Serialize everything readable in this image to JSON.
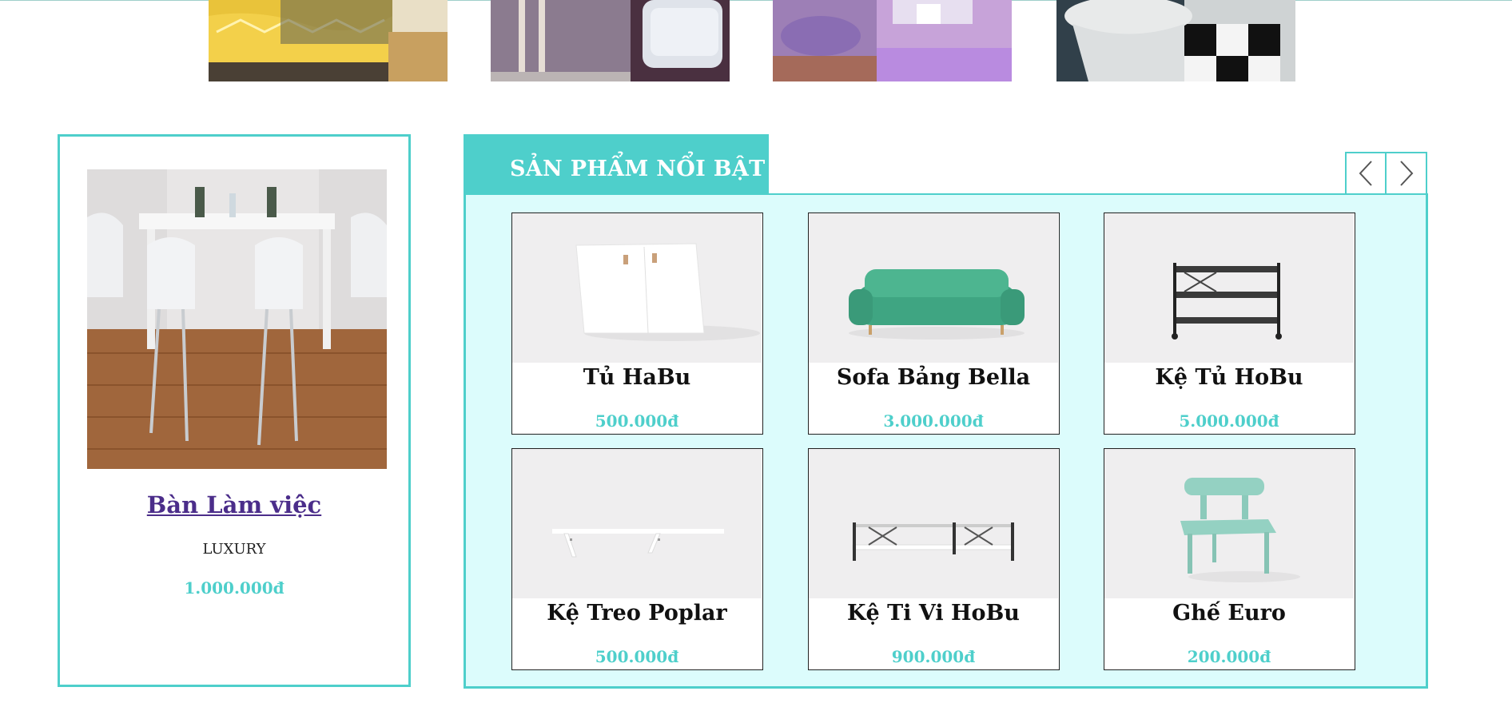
{
  "categories": [
    {
      "name": "bedroom-category-image"
    },
    {
      "name": "livingroom-category-image"
    },
    {
      "name": "kids-room-category-image"
    },
    {
      "name": "bathroom-category-image"
    }
  ],
  "feature": {
    "title": "Bàn Làm việc",
    "subtitle": "LUXURY",
    "price": "1.000.000đ"
  },
  "panel": {
    "heading": "SẢN PHẨM NỔI BẬT",
    "prev_icon": "chevron-left-icon",
    "next_icon": "chevron-right-icon"
  },
  "products": [
    {
      "name": "Tủ HaBu",
      "price": "500.000đ"
    },
    {
      "name": "Sofa Bảng Bella",
      "price": "3.000.000đ"
    },
    {
      "name": "Kệ Tủ HoBu",
      "price": "5.000.000đ"
    },
    {
      "name": "Kệ Treo Poplar",
      "price": "500.000đ"
    },
    {
      "name": "Kệ Ti Vi HoBu",
      "price": "900.000đ"
    },
    {
      "name": "Ghế Euro",
      "price": "200.000đ"
    }
  ],
  "colors": {
    "accent": "#4ecfcb",
    "panel_bg": "#dcfcfc",
    "link": "#4b2d8a"
  }
}
